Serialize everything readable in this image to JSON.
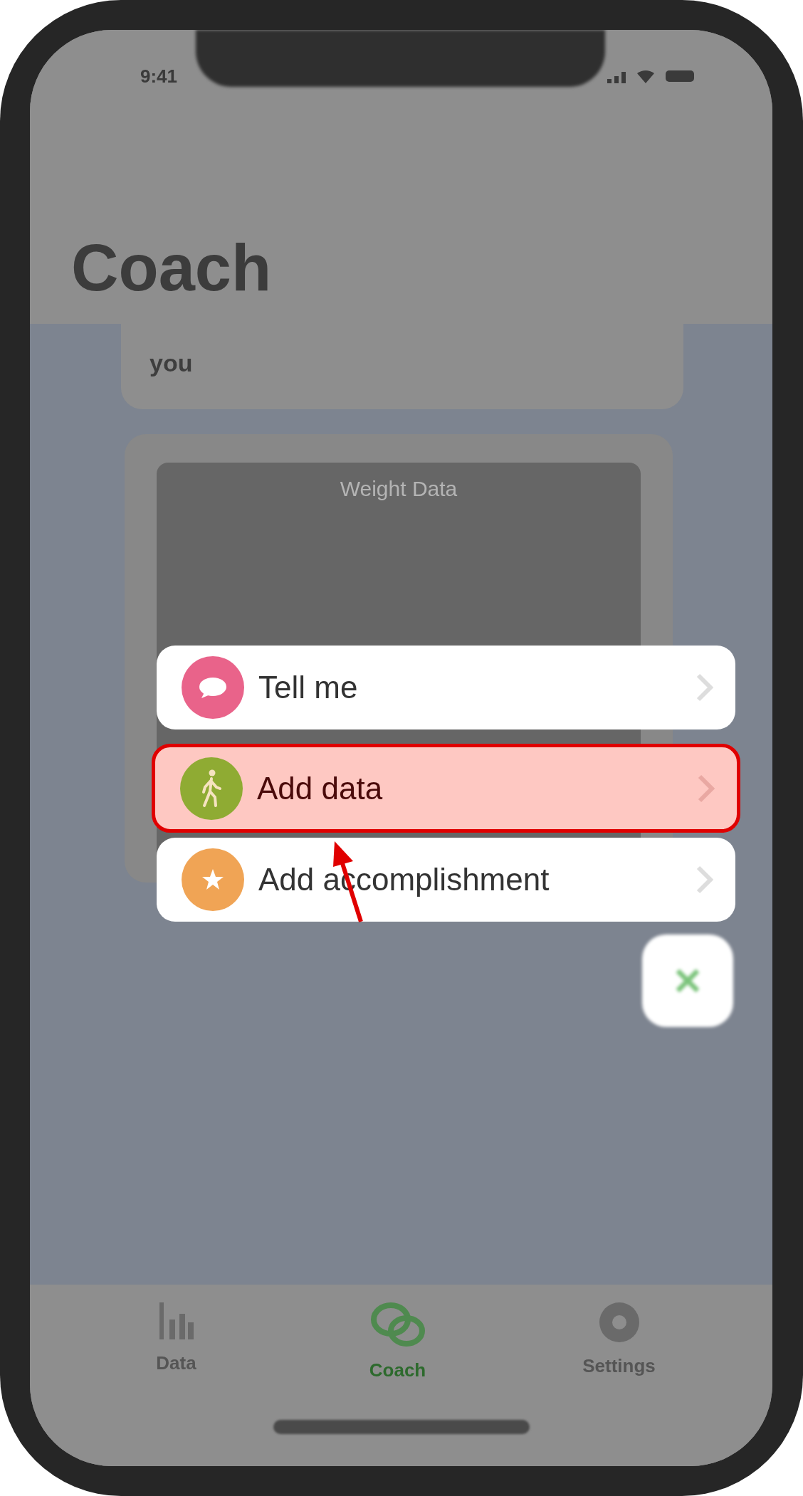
{
  "status_bar": {
    "time": "9:41"
  },
  "header": {
    "title": "Coach"
  },
  "feed": {
    "message": "you",
    "chart_card": {
      "title": "Weight Data"
    }
  },
  "menu_items": [
    {
      "kind": "chat",
      "label": "Tell me",
      "color": "#e9638a",
      "selected": false
    },
    {
      "kind": "walk",
      "label": "Add data",
      "color": "#8fab33",
      "selected": true
    },
    {
      "kind": "star",
      "label": "Add accomplishment",
      "color": "#f0a455",
      "selected": false
    }
  ],
  "tabs": [
    {
      "kind": "chart",
      "label": "Data",
      "selected": false
    },
    {
      "kind": "chat",
      "label": "Coach",
      "selected": true
    },
    {
      "kind": "gear",
      "label": "Settings",
      "selected": false
    }
  ]
}
